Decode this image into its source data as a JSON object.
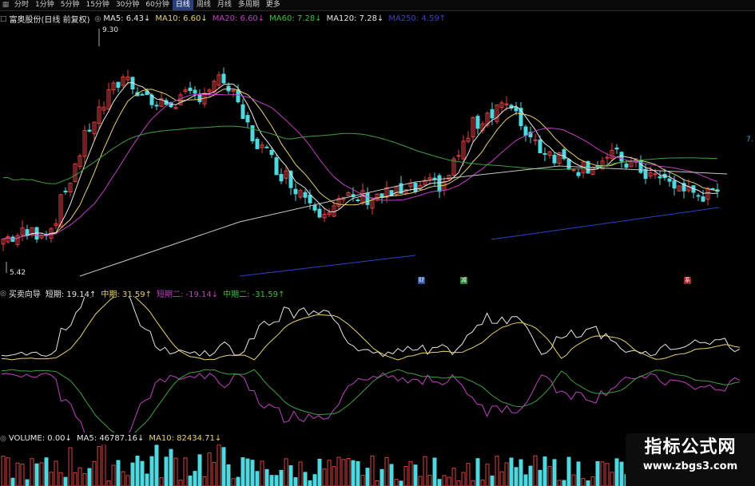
{
  "toolbar": {
    "icon": "chart-icon",
    "tabs": [
      "分时",
      "1分钟",
      "5分钟",
      "15分钟",
      "30分钟",
      "60分钟",
      "日线",
      "周线",
      "月线",
      "多周期",
      "更多"
    ],
    "active": "日线"
  },
  "main": {
    "stock": "富奥股份(日线 前复权)",
    "ma": [
      {
        "label": "MA5: 6.43↓",
        "color": "#e6e6e6"
      },
      {
        "label": "MA10: 6.60↓",
        "color": "#e6d36a"
      },
      {
        "label": "MA20: 6.60↓",
        "color": "#c040c0"
      },
      {
        "label": "MA60: 7.28↓",
        "color": "#40c040"
      },
      {
        "label": "MA120: 7.28↓",
        "color": "#e6e6e6"
      },
      {
        "label": "MA250: 4.59↑",
        "color": "#4040d0"
      }
    ],
    "high_label": "9.30",
    "low_label": "5.42",
    "right_label": "7.",
    "markers": [
      {
        "text": "财",
        "color": "#3a6fc0"
      },
      {
        "text": "减",
        "color": "#3aa04a"
      },
      {
        "text": "系",
        "color": "#c03a3a"
      }
    ]
  },
  "indicator": {
    "name": "买卖向导",
    "items": [
      {
        "label": "短期: 19.14↑",
        "color": "#e6e6e6"
      },
      {
        "label": "中期: 31.59↑",
        "color": "#e6d36a"
      },
      {
        "label": "短期二: -19.14↓",
        "color": "#c040c0"
      },
      {
        "label": "中期二: -31.59↑",
        "color": "#40c040"
      }
    ]
  },
  "volume": {
    "items": [
      {
        "label": "VOLUME: 0.00↓",
        "color": "#e6e6e6"
      },
      {
        "label": "MA5: 46787.16↓",
        "color": "#e6e6e6"
      },
      {
        "label": "MA10: 82434.71↓",
        "color": "#e6d36a"
      }
    ]
  },
  "watermark": {
    "title": "指标公式网",
    "url": "www.zbgs3.com"
  },
  "colors": {
    "up": "#e04040",
    "down": "#50d8e0",
    "bg": "#000000"
  }
}
